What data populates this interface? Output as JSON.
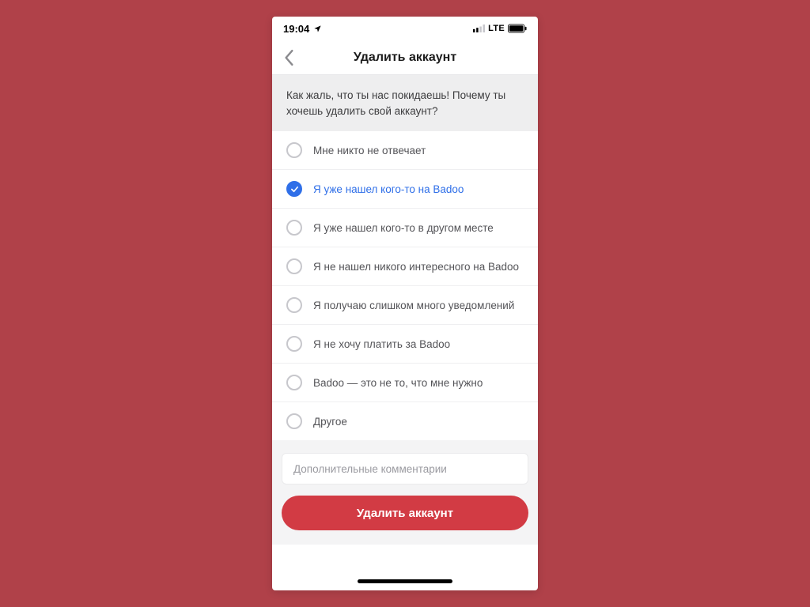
{
  "statusbar": {
    "time": "19:04",
    "network_label": "LTE"
  },
  "header": {
    "title": "Удалить аккаунт"
  },
  "prompt": "Как жаль, что ты нас покидаешь! Почему ты хочешь удалить свой аккаунт?",
  "options": [
    {
      "label": "Мне никто не отвечает",
      "selected": false
    },
    {
      "label": "Я уже нашел кого-то на Badoo",
      "selected": true
    },
    {
      "label": "Я уже нашел кого-то в другом месте",
      "selected": false
    },
    {
      "label": "Я не нашел никого интересного на Badoo",
      "selected": false
    },
    {
      "label": "Я получаю слишком много уведомлений",
      "selected": false
    },
    {
      "label": "Я не хочу платить за Badoo",
      "selected": false
    },
    {
      "label": "Badoo — это не то, что мне нужно",
      "selected": false
    },
    {
      "label": "Другое",
      "selected": false
    }
  ],
  "comment_placeholder": "Дополнительные комментарии",
  "delete_button_label": "Удалить аккаунт",
  "colors": {
    "page_bg": "#b04149",
    "accent_blue": "#2f6fe8",
    "accent_red": "#d23b44"
  }
}
